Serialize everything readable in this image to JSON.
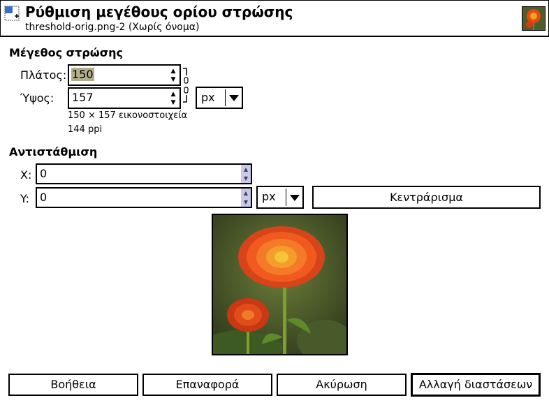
{
  "header": {
    "title": "Ρύθμιση μεγέθους ορίου στρώσης",
    "subtitle": "threshold-orig.png-2 (Χωρίς όνομα)",
    "icon": "resize-canvas-icon",
    "thumbnail": "image-thumbnail"
  },
  "layer_size": {
    "section_title": "Μέγεθος στρώσης",
    "width_label": "Πλάτος:",
    "width_value": "150",
    "height_label": "Ύψος:",
    "height_value": "157",
    "unit": "px",
    "dimensions_text": "150 × 157 εικονοστοιχεία",
    "resolution_text": "144 ppi"
  },
  "offset": {
    "section_title": "Αντιστάθμιση",
    "x_label": "X:",
    "x_value": "0",
    "y_label": "Y:",
    "y_value": "0",
    "unit": "px",
    "center_button": "Κεντράρισμα"
  },
  "buttons": {
    "help": "Βοήθεια",
    "reset": "Επαναφορά",
    "cancel": "Ακύρωση",
    "resize": "Αλλαγή διαστάσεων"
  },
  "colors": {
    "selection": "#b2ad8a",
    "spin_arrows": "#c9c9f0"
  }
}
